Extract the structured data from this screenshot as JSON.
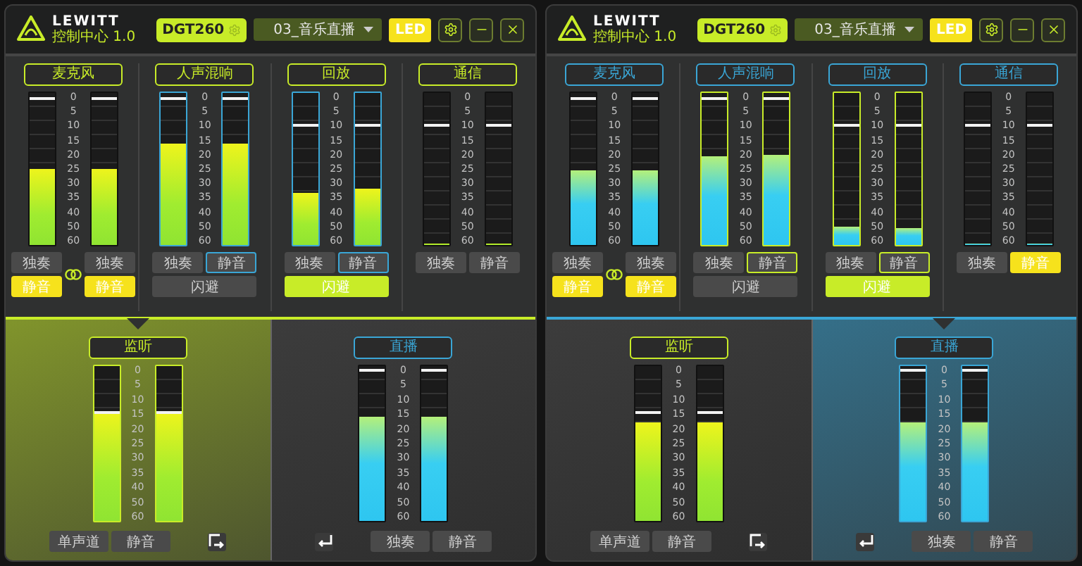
{
  "windows": [
    {
      "header": {
        "brand": "LEWITT",
        "subtitle": "控制中心 1.0",
        "device": "DGT260",
        "preset": "03_音乐直播",
        "led": {
          "label": "LED",
          "on": true
        }
      },
      "groups": [
        {
          "title": "麦克风",
          "kind": "linked",
          "highlighted": false,
          "scale": [
            "0",
            "5",
            "10",
            "15",
            "20",
            "25",
            "30",
            "35",
            "40",
            "50",
            "60"
          ],
          "meters": [
            {
              "level": 0.5,
              "fader": {
                "level": 0.97
              },
              "buttons": [
                {
                  "label": "独奏",
                  "on": false
                },
                {
                  "label": "静音",
                  "on": true
                }
              ]
            },
            {
              "level": 0.5,
              "fader": {
                "level": 0.97
              },
              "buttons": [
                {
                  "label": "独奏",
                  "on": false
                },
                {
                  "label": "静音",
                  "on": true
                }
              ]
            }
          ]
        },
        {
          "title": "人声混响",
          "kind": "shared",
          "highlighted": true,
          "scale": [
            "0",
            "5",
            "10",
            "15",
            "20",
            "25",
            "30",
            "35",
            "40",
            "50",
            "60"
          ],
          "meters": [
            {
              "level": 0.67,
              "fader": {
                "level": 0.97
              }
            },
            {
              "level": 0.67,
              "fader": {
                "level": 0.97
              }
            }
          ],
          "buttons": [
            {
              "label": "独奏",
              "on": false
            },
            {
              "label": "静音",
              "on": false
            }
          ],
          "duck": {
            "label": "闪避",
            "on": false
          }
        },
        {
          "title": "回放",
          "kind": "shared",
          "highlighted": true,
          "scale": [
            "0",
            "5",
            "10",
            "15",
            "20",
            "25",
            "30",
            "35",
            "40",
            "50",
            "60"
          ],
          "meters": [
            {
              "level": 0.34,
              "fader": {
                "level": 0.8
              }
            },
            {
              "level": 0.37,
              "fader": {
                "level": 0.8
              }
            }
          ],
          "buttons": [
            {
              "label": "独奏",
              "on": false
            },
            {
              "label": "静音",
              "on": false
            }
          ],
          "duck": {
            "label": "闪避",
            "on": true
          }
        },
        {
          "title": "通信",
          "kind": "shared",
          "highlighted": false,
          "scale": [
            "0",
            "5",
            "10",
            "15",
            "20",
            "25",
            "30",
            "35",
            "40",
            "50",
            "60"
          ],
          "meters": [
            {
              "level": 0,
              "fader": {
                "level": 0.8
              }
            },
            {
              "level": 0,
              "fader": {
                "level": 0.8
              }
            }
          ],
          "buttons": [
            {
              "label": "独奏",
              "on": false
            },
            {
              "label": "静音",
              "on": false
            }
          ]
        }
      ],
      "outputs": [
        {
          "label": "监听",
          "selected": true,
          "color": "#c8ec28",
          "scale": [
            "0",
            "5",
            "10",
            "15",
            "20",
            "25",
            "30",
            "35",
            "40",
            "50",
            "60"
          ],
          "meters": [
            {
              "level": 0.7,
              "fader": {
                "level": 0.71
              }
            },
            {
              "level": 0.7,
              "fader": {
                "level": 0.71
              }
            }
          ],
          "buttons": [
            {
              "label": "单声道",
              "on": false
            },
            {
              "label": "静音",
              "on": false
            }
          ]
        },
        {
          "label": "直播",
          "selected": false,
          "color": "#3aa6d6",
          "scale": [
            "0",
            "5",
            "10",
            "15",
            "20",
            "25",
            "30",
            "35",
            "40",
            "50",
            "60"
          ],
          "meters": [
            {
              "level": 0.67,
              "fader": {
                "level": 0.98
              }
            },
            {
              "level": 0.67,
              "fader": {
                "level": 0.98
              }
            }
          ],
          "buttons": [
            {
              "label": "独奏",
              "on": false
            },
            {
              "label": "静音",
              "on": false
            }
          ]
        }
      ]
    },
    {
      "header": {
        "brand": "LEWITT",
        "subtitle": "控制中心 1.0",
        "device": "DGT260",
        "preset": "03_音乐直播",
        "led": {
          "label": "LED",
          "on": true
        }
      },
      "groups": [
        {
          "title": "麦克风",
          "kind": "linked",
          "highlighted": false,
          "scale": [
            "0",
            "5",
            "10",
            "15",
            "20",
            "25",
            "30",
            "35",
            "40",
            "50",
            "60"
          ],
          "meters": [
            {
              "level": 0.49,
              "fader": {
                "level": 0.97
              },
              "buttons": [
                {
                  "label": "独奏",
                  "on": false
                },
                {
                  "label": "静音",
                  "on": true
                }
              ]
            },
            {
              "level": 0.49,
              "fader": {
                "level": 0.97
              },
              "buttons": [
                {
                  "label": "独奏",
                  "on": false
                },
                {
                  "label": "静音",
                  "on": true
                }
              ]
            }
          ]
        },
        {
          "title": "人声混响",
          "kind": "shared",
          "highlighted": true,
          "scale": [
            "0",
            "5",
            "10",
            "15",
            "20",
            "25",
            "30",
            "35",
            "40",
            "50",
            "60"
          ],
          "meters": [
            {
              "level": 0.58,
              "fader": {
                "level": 0.97
              }
            },
            {
              "level": 0.59,
              "fader": {
                "level": 0.97
              }
            }
          ],
          "buttons": [
            {
              "label": "独奏",
              "on": false
            },
            {
              "label": "静音",
              "on": false
            }
          ],
          "duck": {
            "label": "闪避",
            "on": false
          }
        },
        {
          "title": "回放",
          "kind": "shared",
          "highlighted": true,
          "scale": [
            "0",
            "5",
            "10",
            "15",
            "20",
            "25",
            "30",
            "35",
            "40",
            "50",
            "60"
          ],
          "meters": [
            {
              "level": 0.12,
              "fader": {
                "level": 0.8
              }
            },
            {
              "level": 0.11,
              "fader": {
                "level": 0.8
              }
            }
          ],
          "buttons": [
            {
              "label": "独奏",
              "on": false
            },
            {
              "label": "静音",
              "on": false
            }
          ],
          "duck": {
            "label": "闪避",
            "on": true
          }
        },
        {
          "title": "通信",
          "kind": "shared",
          "highlighted": false,
          "scale": [
            "0",
            "5",
            "10",
            "15",
            "20",
            "25",
            "30",
            "35",
            "40",
            "50",
            "60"
          ],
          "meters": [
            {
              "level": 0,
              "fader": {
                "level": 0.8
              }
            },
            {
              "level": 0,
              "fader": {
                "level": 0.8
              }
            }
          ],
          "buttons": [
            {
              "label": "独奏",
              "on": false
            },
            {
              "label": "静音",
              "on": true
            }
          ]
        }
      ],
      "outputs": [
        {
          "label": "监听",
          "selected": false,
          "color": "#c8ec28",
          "scale": [
            "0",
            "5",
            "10",
            "15",
            "20",
            "25",
            "30",
            "35",
            "40",
            "50",
            "60"
          ],
          "meters": [
            {
              "level": 0.64,
              "fader": {
                "level": 0.71
              }
            },
            {
              "level": 0.64,
              "fader": {
                "level": 0.71
              }
            }
          ],
          "buttons": [
            {
              "label": "单声道",
              "on": false
            },
            {
              "label": "静音",
              "on": false
            }
          ]
        },
        {
          "label": "直播",
          "selected": true,
          "color": "#3aa6d6",
          "scale": [
            "0",
            "5",
            "10",
            "15",
            "20",
            "25",
            "30",
            "35",
            "40",
            "50",
            "60"
          ],
          "meters": [
            {
              "level": 0.64,
              "fader": {
                "level": 0.98
              }
            },
            {
              "level": 0.64,
              "fader": {
                "level": 0.98
              }
            }
          ],
          "buttons": [
            {
              "label": "独奏",
              "on": false
            },
            {
              "label": "静音",
              "on": false
            }
          ]
        }
      ]
    }
  ]
}
